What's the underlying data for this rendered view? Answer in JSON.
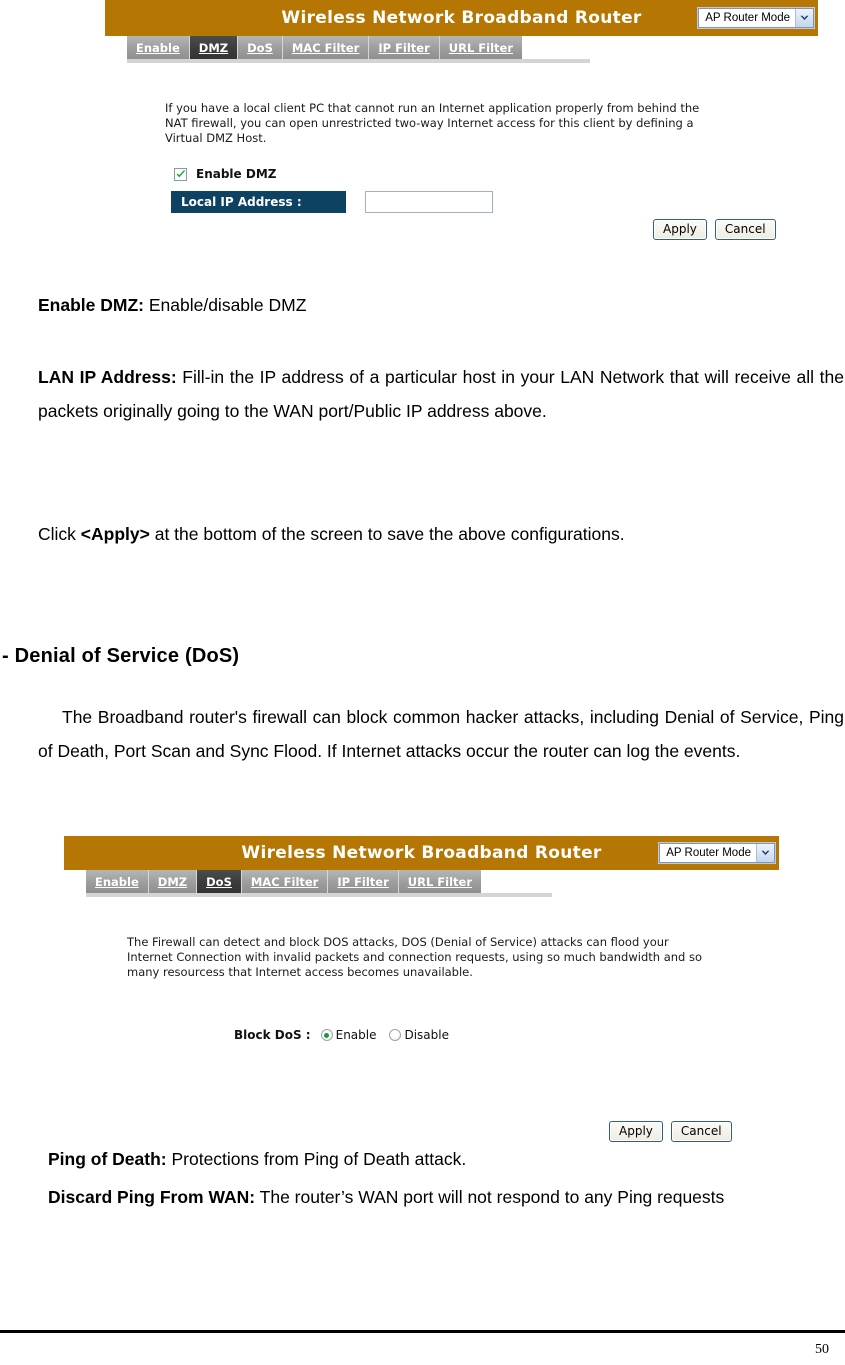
{
  "page": {
    "number": "50"
  },
  "panel_dmz": {
    "title": "Wireless Network Broadband Router",
    "mode_select": {
      "value": "AP Router Mode",
      "options": [
        "AP Router Mode"
      ]
    },
    "tabs": [
      {
        "label": "Enable",
        "active": false
      },
      {
        "label": "DMZ",
        "active": true
      },
      {
        "label": "DoS",
        "active": false
      },
      {
        "label": "MAC Filter",
        "active": false
      },
      {
        "label": "IP Filter",
        "active": false
      },
      {
        "label": "URL Filter",
        "active": false
      }
    ],
    "description": "If you have a local client PC that cannot run an Internet application properly from behind the NAT firewall, you can open unrestricted two-way Internet access for this client by defining a Virtual DMZ Host.",
    "enable_dmz_label": "Enable DMZ",
    "enable_dmz_checked": true,
    "local_ip_label": "Local IP Address :",
    "local_ip_value": "",
    "local_ip_placeholder": "",
    "apply_label": "Apply",
    "cancel_label": "Cancel"
  },
  "panel_dos": {
    "title": "Wireless Network Broadband Router",
    "mode_select": {
      "value": "AP Router Mode",
      "options": [
        "AP Router Mode"
      ]
    },
    "tabs": [
      {
        "label": "Enable",
        "active": false
      },
      {
        "label": "DMZ",
        "active": false
      },
      {
        "label": "DoS",
        "active": true
      },
      {
        "label": "MAC Filter",
        "active": false
      },
      {
        "label": "IP Filter",
        "active": false
      },
      {
        "label": "URL Filter",
        "active": false
      }
    ],
    "description": "The Firewall can detect and block DOS attacks, DOS (Denial of Service) attacks can flood your Internet Connection with invalid packets and connection requests, using so much bandwidth and so many resourcess that Internet access becomes unavailable.",
    "block_dos_label": "Block DoS :",
    "radio_enable_label": "Enable",
    "radio_disable_label": "Disable",
    "radio_selected": "Enable",
    "apply_label": "Apply",
    "cancel_label": "Cancel"
  },
  "doc": {
    "enable_dmz_term": "Enable DMZ:",
    "enable_dmz_desc": " Enable/disable DMZ",
    "lan_ip_term": "LAN IP Address:",
    "lan_ip_desc": " Fill-in the IP address of a particular host in your LAN Network that will receive all the packets originally going to the WAN port/Public IP address above.",
    "click_apply_pre": "Click ",
    "click_apply_bold": "<Apply>",
    "click_apply_post": " at the bottom of the screen to save the above configurations.",
    "dos_heading": "- Denial of Service (DoS)",
    "dos_paragraph": "The Broadband router's firewall can block common hacker attacks, including Denial of Service, Ping of Death, Port Scan and Sync Flood. If Internet attacks occur the router can log the events.",
    "ping_death_term": "Ping of Death:",
    "ping_death_desc": "  Protections from Ping of Death attack.",
    "discard_ping_term": "Discard Ping From WAN:",
    "discard_ping_desc": " The router’s WAN port will not respond to any Ping requests"
  }
}
